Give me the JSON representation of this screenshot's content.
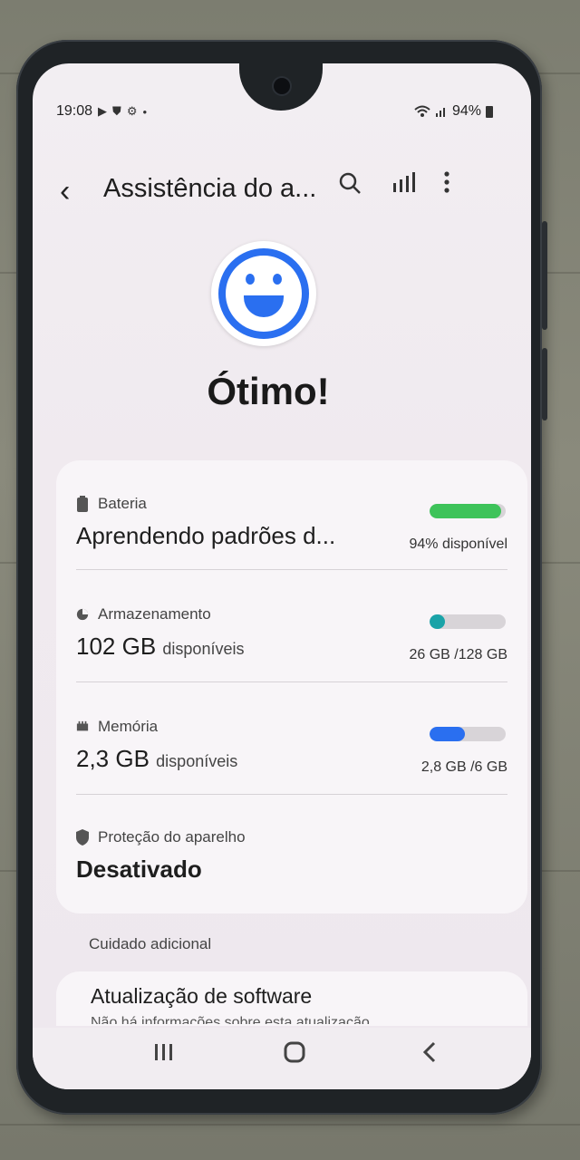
{
  "status_bar": {
    "time": "19:08",
    "battery": "94%",
    "left_icons": [
      "play-icon",
      "shield-icon",
      "gear-icon",
      "dot-icon"
    ],
    "right_icons": [
      "wifi-icon",
      "signal-icon",
      "battery-icon"
    ]
  },
  "header": {
    "title": "Assistência do a...",
    "icons": [
      "back-icon",
      "search-icon",
      "bars-icon",
      "more-icon"
    ]
  },
  "status_summary": {
    "headline": "Ótimo!",
    "icon": "smiley-icon",
    "color": "#2a6ff0"
  },
  "battery": {
    "label": "Bateria",
    "main": "Aprendendo padrões d...",
    "value": "94% disponível",
    "fill_fraction": 0.94,
    "fill_color": "#3ec35a"
  },
  "storage": {
    "label": "Armazenamento",
    "main_value": "102 GB",
    "main_suffix": "disponíveis",
    "value": "26 GB /128 GB",
    "fill_fraction": 0.2,
    "fill_color": "#1aa3a8"
  },
  "memory": {
    "label": "Memória",
    "main_value": "2,3 GB",
    "main_suffix": "disponíveis",
    "value": "2,8 GB /6 GB",
    "fill_fraction": 0.47,
    "fill_color": "#2a6ff0"
  },
  "protection": {
    "label": "Proteção do aparelho",
    "main": "Desativado"
  },
  "extra_care": {
    "section_title": "Cuidado adicional",
    "item_title": "Atualização de software",
    "item_subtitle": "Não há informações sobre esta atualização"
  },
  "navbar": {
    "icons": [
      "recent-apps-icon",
      "home-icon",
      "back-nav-icon"
    ]
  }
}
